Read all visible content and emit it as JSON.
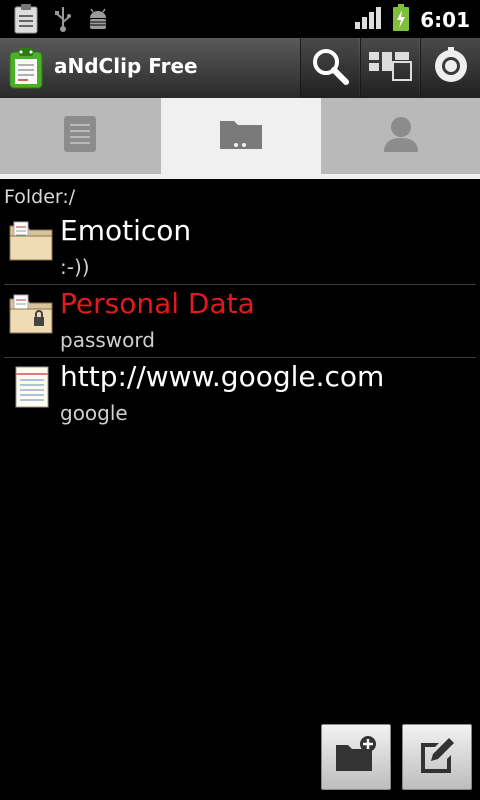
{
  "status_bar": {
    "time": "6:01",
    "left_icons": [
      "clipboard-notification-icon",
      "usb-icon",
      "android-debug-icon"
    ],
    "right_icons": [
      "signal-icon",
      "battery-charging-icon"
    ]
  },
  "app": {
    "title": "aNdClip Free",
    "toolbar_icons": [
      "search-icon",
      "widgets-icon",
      "settings-icon"
    ]
  },
  "tabs": [
    {
      "icon": "list-icon",
      "active": false
    },
    {
      "icon": "folder-icon",
      "active": true
    },
    {
      "icon": "person-icon",
      "active": false
    }
  ],
  "folder_path": "Folder:/",
  "items": [
    {
      "title": "Emoticon",
      "subtitle": ":-))",
      "icon": "folder-doc-icon",
      "title_color": "#ffffff"
    },
    {
      "title": "Personal Data",
      "subtitle": "password",
      "icon": "folder-locked-icon",
      "title_color": "#e11b1b"
    },
    {
      "title": "http://www.google.com",
      "subtitle": "google",
      "icon": "note-icon",
      "title_color": "#ffffff"
    }
  ],
  "bottom_actions": [
    "new-folder-icon",
    "edit-note-icon"
  ],
  "colors": {
    "accent_red": "#e11b1b",
    "background": "#000000",
    "tab_active": "#f0f0f0",
    "tab_inactive": "#b9b9b9"
  }
}
